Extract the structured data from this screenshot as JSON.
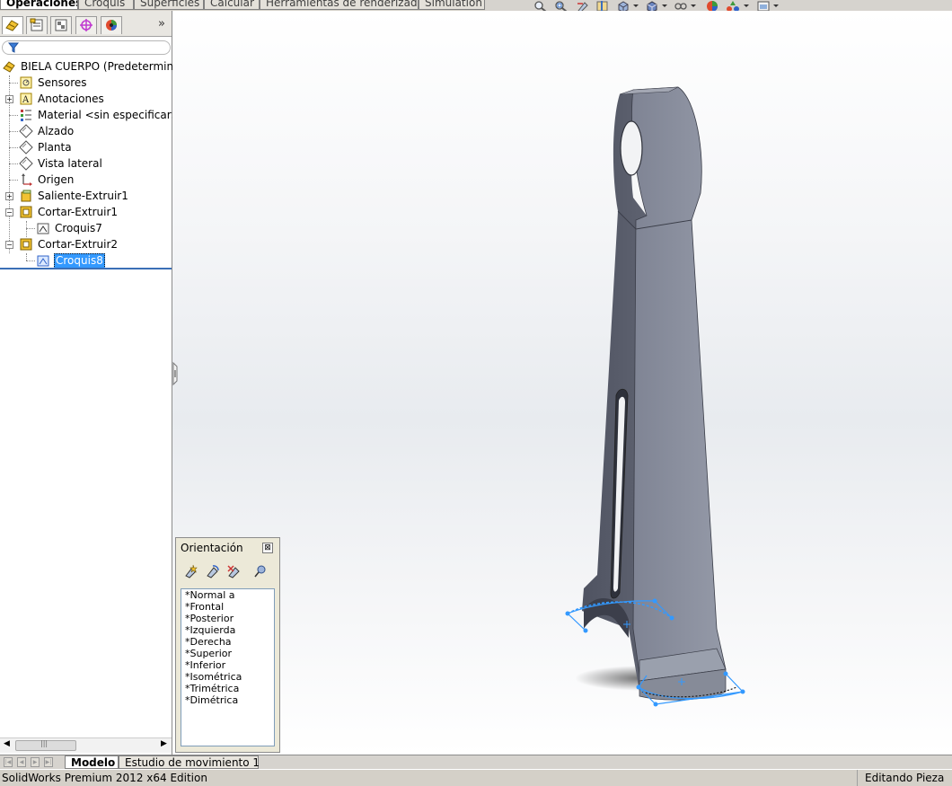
{
  "command_tabs": [
    "Operaciones",
    "Croquis",
    "Superficies",
    "Calcular",
    "Herramientas de renderizado",
    "Simulation"
  ],
  "active_command_tab": "Operaciones",
  "view_toolbar_icons": [
    "zoom-to-fit-icon",
    "zoom-area-icon",
    "previous-view-icon",
    "section-view-icon",
    "view-orientation-icon",
    "display-style-icon",
    "hide-show-items-icon",
    "edit-appearance-icon",
    "apply-scene-icon",
    "view-settings-icon"
  ],
  "panel_tabs": [
    "featuremanager-icon",
    "propertymanager-icon",
    "configurationmanager-icon",
    "dimxpertmanager-icon",
    "displaymanager-icon"
  ],
  "tree": {
    "root": "BIELA CUERPO  (Predeterminado",
    "items": [
      {
        "label": "Sensores",
        "icon": "sensors-icon"
      },
      {
        "label": "Anotaciones",
        "icon": "annotations-icon"
      },
      {
        "label": "Material <sin especificar>",
        "icon": "material-icon"
      },
      {
        "label": "Alzado",
        "icon": "plane-icon"
      },
      {
        "label": "Planta",
        "icon": "plane-icon"
      },
      {
        "label": "Vista lateral",
        "icon": "plane-icon"
      },
      {
        "label": "Origen",
        "icon": "origin-icon"
      },
      {
        "label": "Saliente-Extruir1",
        "icon": "extrude-boss-icon"
      },
      {
        "label": "Cortar-Extruir1",
        "icon": "extrude-cut-icon"
      },
      {
        "label": "Croquis7",
        "icon": "sketch-icon"
      },
      {
        "label": "Cortar-Extruir2",
        "icon": "extrude-cut-icon"
      },
      {
        "label": "Croquis8",
        "icon": "sketch-icon",
        "selected": true
      }
    ]
  },
  "orientation": {
    "title": "Orientación",
    "views": [
      "*Normal a",
      "*Frontal",
      "*Posterior",
      "*Izquierda",
      "*Derecha",
      "*Superior",
      "*Inferior",
      "*Isométrica",
      "*Trimétrica",
      "*Dimétrica"
    ]
  },
  "bottom_tabs": [
    "Modelo",
    "Estudio de movimiento 1"
  ],
  "status": {
    "left": "SolidWorks Premium 2012 x64 Edition",
    "right": "Editando Pieza"
  },
  "colors": {
    "selection": "#3399ff",
    "sketch": "#3399ff",
    "part_face": "#8e929f"
  }
}
